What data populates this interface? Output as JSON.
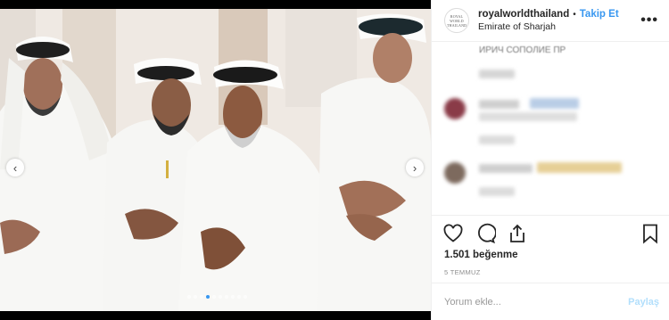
{
  "header": {
    "avatar_text": "ROYAL WORLD THAILAND",
    "username": "royalworldthailand",
    "bullet": "•",
    "follow_label": "Takip Et",
    "location": "Emirate of Sharjah",
    "more_label": "•••"
  },
  "comments": {
    "cut_text": "ИРИЧ СОПОЛИЕ ПР"
  },
  "carousel": {
    "prev_label": "‹",
    "next_label": "›",
    "dot_count": 10,
    "active_dot": 3
  },
  "actions": {
    "like_icon": "heart-icon",
    "comment_icon": "comment-icon",
    "share_icon": "share-icon",
    "save_icon": "bookmark-icon"
  },
  "likes_text": "1.501 beğenme",
  "date_text": "5 TEMMUZ",
  "comment_box": {
    "placeholder": "Yorum ekle...",
    "post_label": "Paylaş"
  },
  "colors": {
    "link_blue": "#3897f0",
    "post_disabled": "#b2dffc",
    "border": "#efefef"
  }
}
